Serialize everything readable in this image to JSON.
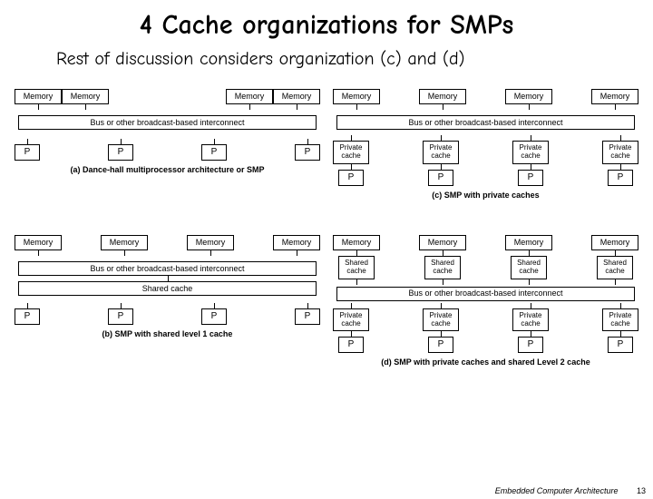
{
  "title": "4 Cache organizations for SMPs",
  "subtitle": "Rest of discussion considers organization (c) and (d)",
  "labels": {
    "memory": "Memory",
    "processor": "P",
    "bus": "Bus or other broadcast-based interconnect",
    "private_cache": "Private\ncache",
    "shared_cache_bar": "Shared cache",
    "shared_cache_box": "Shared\ncache"
  },
  "panels": {
    "a": {
      "caption": "(a) Dance-hall multiprocessor architecture or SMP",
      "top_boxes": [
        "memory",
        "memory",
        "memory"
      ],
      "top_right_box": "memory",
      "bottom_boxes": [
        "processor",
        "processor",
        "processor",
        "processor"
      ],
      "bus_label": "bus"
    },
    "b": {
      "caption": "(b) SMP with shared level 1 cache",
      "top_boxes": [
        "memory",
        "memory",
        "memory",
        "memory"
      ],
      "bus_label": "bus",
      "shared_bar": "shared_cache_bar",
      "bottom_boxes": [
        "processor",
        "processor",
        "processor",
        "processor"
      ]
    },
    "c": {
      "caption": "(c) SMP with private caches",
      "top_boxes": [
        "memory",
        "memory",
        "memory",
        "memory"
      ],
      "bus_label": "bus",
      "mid_boxes": [
        "private_cache",
        "private_cache",
        "private_cache",
        "private_cache"
      ],
      "bottom_boxes": [
        "processor",
        "processor",
        "processor",
        "processor"
      ]
    },
    "d": {
      "caption": "(d) SMP with private caches and shared Level 2 cache",
      "top_boxes": [
        "memory",
        "memory",
        "memory",
        "memory"
      ],
      "shared_boxes": [
        "shared_cache_box",
        "shared_cache_box",
        "shared_cache_box",
        "shared_cache_box"
      ],
      "bus_label": "bus",
      "mid_boxes": [
        "private_cache",
        "private_cache",
        "private_cache",
        "private_cache"
      ],
      "bottom_boxes": [
        "processor",
        "processor",
        "processor",
        "processor"
      ]
    }
  },
  "footer": {
    "text": "Embedded Computer Architecture",
    "page": "13"
  }
}
